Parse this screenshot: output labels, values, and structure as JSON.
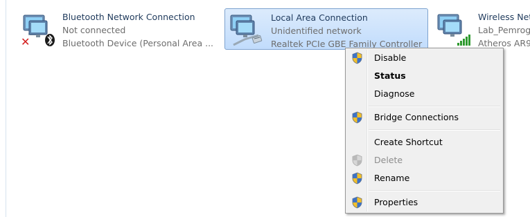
{
  "connections": [
    {
      "name": "Bluetooth Network Connection",
      "status": "Not connected",
      "device": "Bluetooth Device (Personal Area ..."
    },
    {
      "name": "Local Area Connection",
      "status": "Unidentified network",
      "device": "Realtek PCIe GBE Family Controller"
    },
    {
      "name": "Wireless Net",
      "status": "Lab_Pemrog",
      "device": "Atheros AR9"
    }
  ],
  "context_menu": {
    "items": [
      {
        "label": "Disable",
        "icon": "shield-icon"
      },
      {
        "label": "Status",
        "icon": ""
      },
      {
        "label": "Diagnose",
        "icon": ""
      },
      {
        "label": "Bridge Connections",
        "icon": "shield-icon"
      },
      {
        "label": "Create Shortcut",
        "icon": ""
      },
      {
        "label": "Delete",
        "icon": "shield-disabled-icon"
      },
      {
        "label": "Rename",
        "icon": "shield-icon"
      },
      {
        "label": "Properties",
        "icon": "shield-icon"
      }
    ]
  },
  "colors": {
    "selection_bg": "#c1dcfc",
    "selection_border": "#7da2ce",
    "link_text": "#1e395b",
    "secondary_text": "#6d6d6d",
    "menu_bg": "#f0f0f0"
  }
}
